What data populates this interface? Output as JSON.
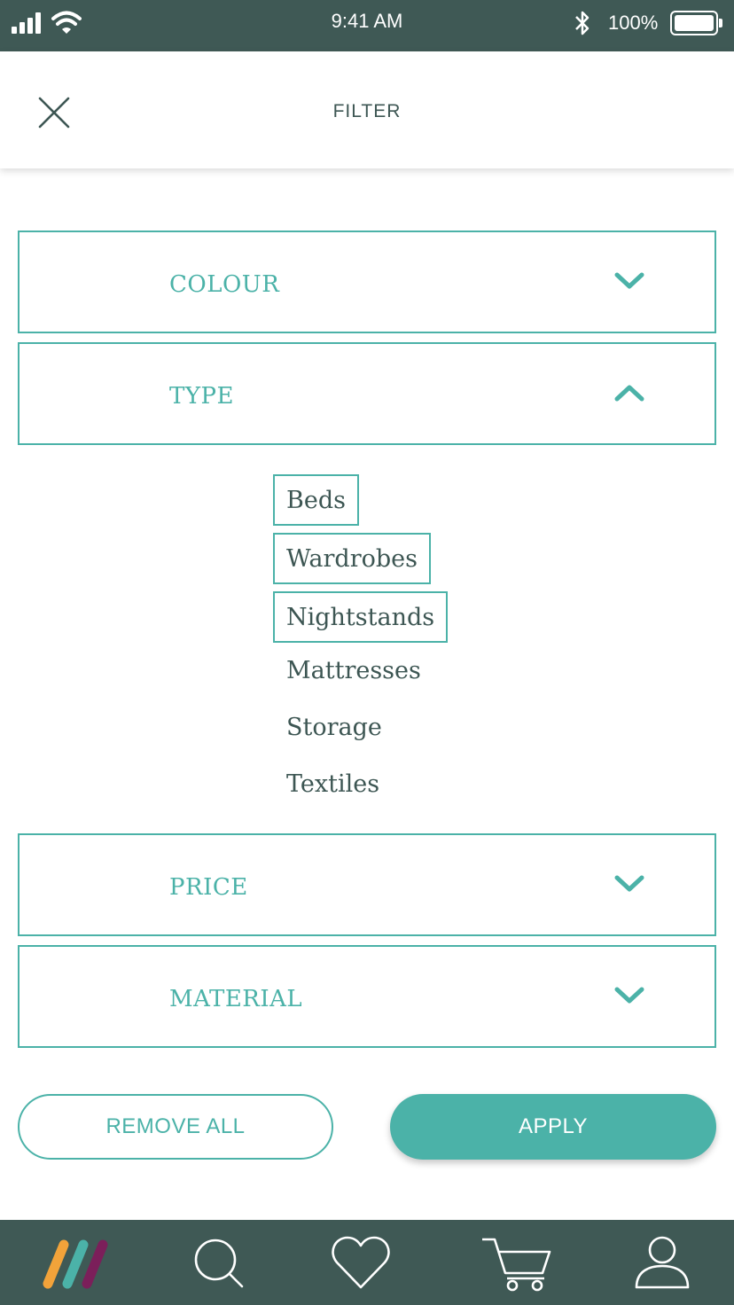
{
  "status_bar": {
    "time": "9:41 AM",
    "battery": "100%"
  },
  "header": {
    "title": "FILTER",
    "close_icon": "close-icon"
  },
  "filters": [
    {
      "label": "COLOUR",
      "expanded": false
    },
    {
      "label": "TYPE",
      "expanded": true
    },
    {
      "label": "PRICE",
      "expanded": false
    },
    {
      "label": "MATERIAL",
      "expanded": false
    }
  ],
  "type_options": [
    {
      "label": "Beds",
      "selected": true
    },
    {
      "label": "Wardrobes",
      "selected": true
    },
    {
      "label": "Nightstands",
      "selected": true
    },
    {
      "label": "Mattresses",
      "selected": false
    },
    {
      "label": "Storage",
      "selected": false
    },
    {
      "label": "Textiles",
      "selected": false
    }
  ],
  "actions": {
    "remove_all": "REMOVE ALL",
    "apply": "APPLY"
  },
  "bottom_nav": [
    "home-logo-icon",
    "search-icon",
    "heart-icon",
    "cart-icon",
    "profile-icon"
  ],
  "colors": {
    "accent": "#4bb2a8",
    "dark": "#3f5955",
    "text": "#3d5653",
    "logo_orange": "#f2a33a",
    "logo_teal": "#4bb2a8",
    "logo_purple": "#7b1f5a"
  }
}
